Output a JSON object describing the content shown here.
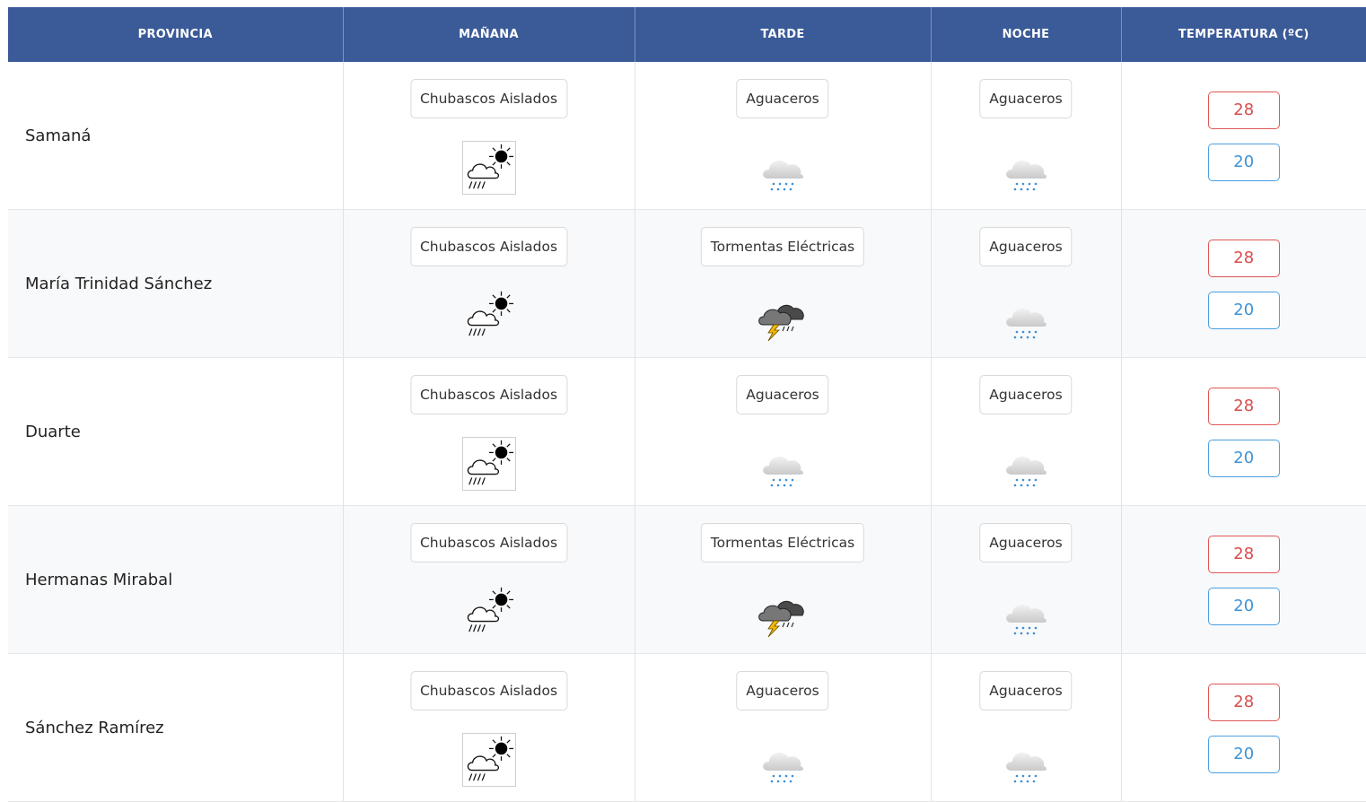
{
  "headers": {
    "provincia": "PROVINCIA",
    "manana": "MAÑANA",
    "tarde": "TARDE",
    "noche": "NOCHE",
    "temperatura": "TEMPERATURA (ºC)"
  },
  "colors": {
    "header_bg": "#3a5a98",
    "max_temp": "#d94c4c",
    "min_temp": "#3d94d8"
  },
  "rows": [
    {
      "provincia": "Samaná",
      "manana": {
        "label": "Chubascos Aislados",
        "icon": "scattered-showers-sun-icon"
      },
      "tarde": {
        "label": "Aguaceros",
        "icon": "rain-cloud-icon"
      },
      "noche": {
        "label": "Aguaceros",
        "icon": "rain-cloud-icon"
      },
      "max": "28",
      "min": "20"
    },
    {
      "provincia": "María Trinidad Sánchez",
      "manana": {
        "label": "Chubascos Aislados",
        "icon": "scattered-showers-sun-icon"
      },
      "tarde": {
        "label": "Tormentas Eléctricas",
        "icon": "thunderstorm-icon"
      },
      "noche": {
        "label": "Aguaceros",
        "icon": "rain-cloud-icon"
      },
      "max": "28",
      "min": "20"
    },
    {
      "provincia": "Duarte",
      "manana": {
        "label": "Chubascos Aislados",
        "icon": "scattered-showers-sun-icon"
      },
      "tarde": {
        "label": "Aguaceros",
        "icon": "rain-cloud-icon"
      },
      "noche": {
        "label": "Aguaceros",
        "icon": "rain-cloud-icon"
      },
      "max": "28",
      "min": "20"
    },
    {
      "provincia": "Hermanas Mirabal",
      "manana": {
        "label": "Chubascos Aislados",
        "icon": "scattered-showers-sun-icon"
      },
      "tarde": {
        "label": "Tormentas Eléctricas",
        "icon": "thunderstorm-icon"
      },
      "noche": {
        "label": "Aguaceros",
        "icon": "rain-cloud-icon"
      },
      "max": "28",
      "min": "20"
    },
    {
      "provincia": "Sánchez Ramírez",
      "manana": {
        "label": "Chubascos Aislados",
        "icon": "scattered-showers-sun-icon"
      },
      "tarde": {
        "label": "Aguaceros",
        "icon": "rain-cloud-icon"
      },
      "noche": {
        "label": "Aguaceros",
        "icon": "rain-cloud-icon"
      },
      "max": "28",
      "min": "20"
    }
  ]
}
